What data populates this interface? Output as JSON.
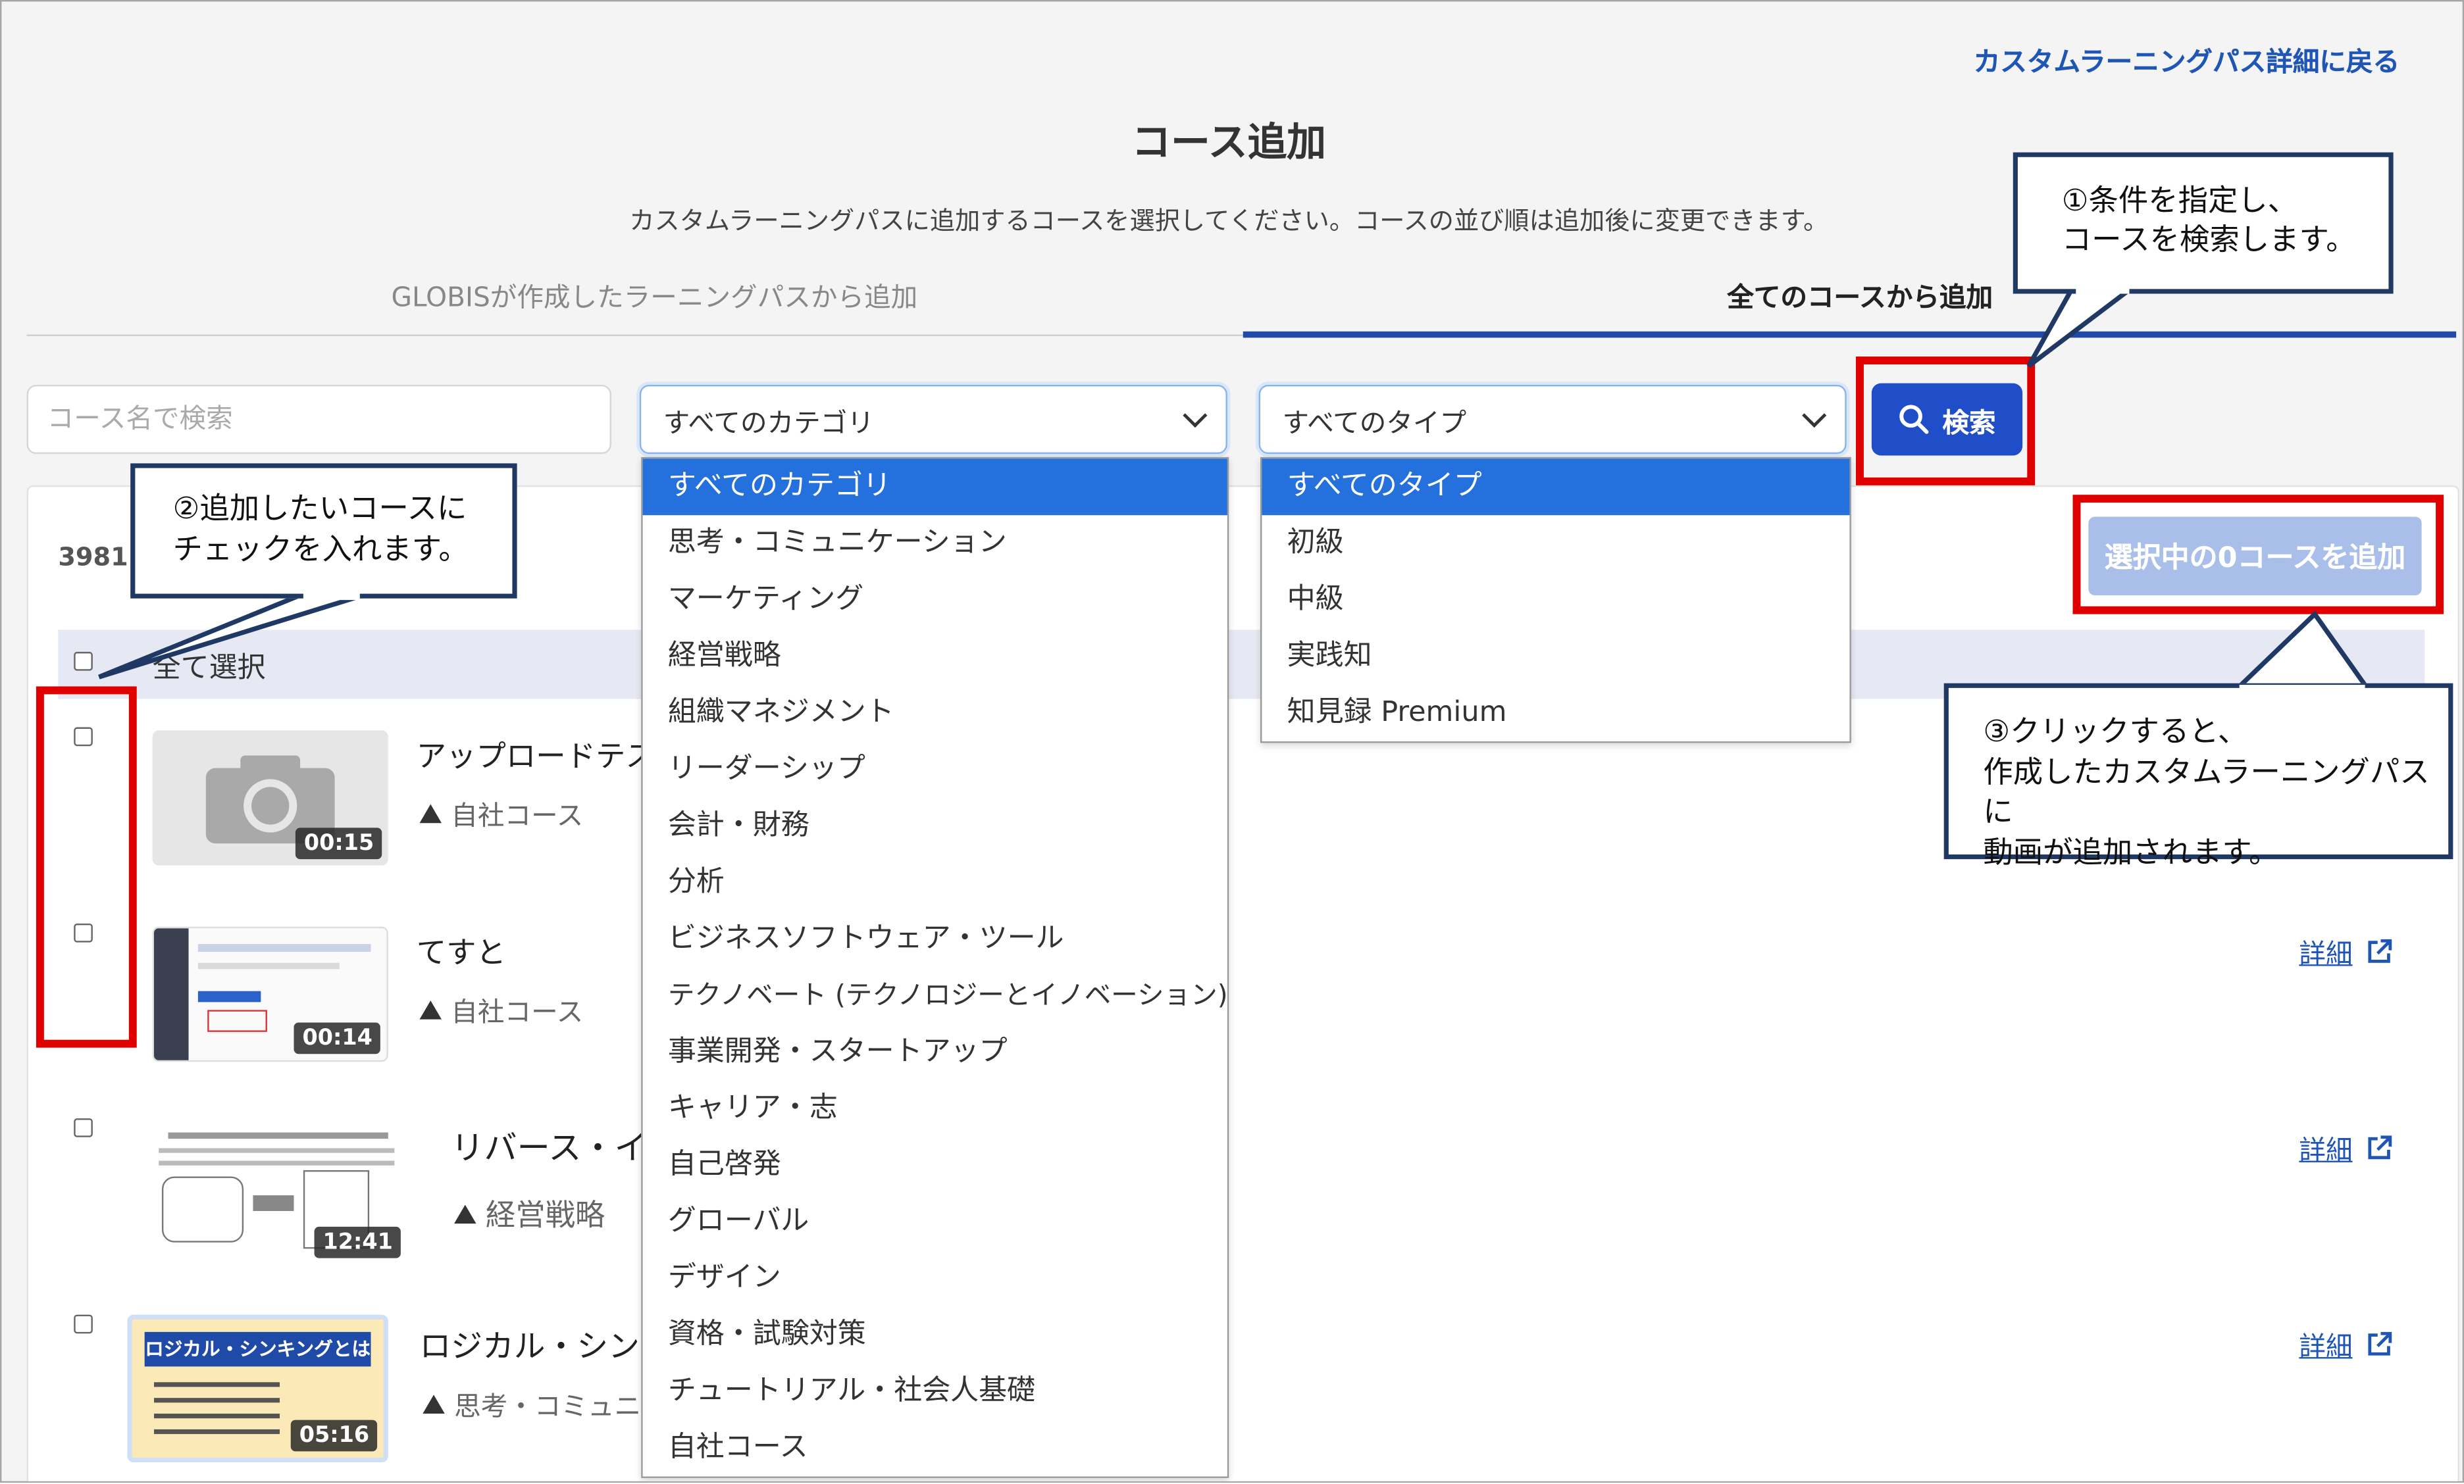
{
  "header": {
    "back_link": "カスタムラーニングパス詳細に戻る",
    "title": "コース追加",
    "subtitle": "カスタムラーニングパスに追加するコースを選択してください。コースの並び順は追加後に変更できます。"
  },
  "tabs": [
    {
      "label": "GLOBISが作成したラーニングパスから追加",
      "active": false
    },
    {
      "label": "全てのコースから追加",
      "active": true
    }
  ],
  "filters": {
    "search_placeholder": "コース名で検索",
    "category_selected": "すべてのカテゴリ",
    "type_selected": "すべてのタイプ",
    "search_button": "検索"
  },
  "category_options": [
    "すべてのカテゴリ",
    "思考・コミュニケーション",
    "マーケティング",
    "経営戦略",
    "組織マネジメント",
    "リーダーシップ",
    "会計・財務",
    "分析",
    "ビジネスソフトウェア・ツール",
    "テクノベート (テクノロジーとイノベーション)",
    "事業開発・スタートアップ",
    "キャリア・志",
    "自己啓発",
    "グローバル",
    "デザイン",
    "資格・試験対策",
    "チュートリアル・社会人基礎",
    "自社コース"
  ],
  "type_options": [
    "すべてのタイプ",
    "初級",
    "中級",
    "実践知",
    "知見録 Premium"
  ],
  "results": {
    "count_text": "3981",
    "add_button": "選択中の0コースを追加",
    "select_all_label": "全て選択"
  },
  "courses": [
    {
      "title": "アップロードテスト",
      "category": "自社コース",
      "duration": "00:15",
      "detail": ""
    },
    {
      "title": "てすと",
      "category": "自社コース",
      "duration": "00:14",
      "detail": "詳細"
    },
    {
      "title": "リバース・イノベ",
      "category": "経営戦略",
      "duration": "12:41",
      "detail": "詳細"
    },
    {
      "title": "ロジカル・シンキン",
      "category": "思考・コミュニケー",
      "duration": "05:16",
      "detail": "詳細",
      "thumb_label": "ロジカル・シンキングとは"
    }
  ],
  "callouts": {
    "c1": "①条件を指定し、\nコースを検索します。",
    "c2": "②追加したいコースに\nチェックを入れます。",
    "c3": "③クリックすると、\n作成したカスタムラーニングパスに\n動画が追加されます。"
  },
  "colors": {
    "primary": "#1f4ec8",
    "link": "#1f56b5",
    "dropdown_selected": "#2470dc",
    "annotation_red": "#e00000",
    "callout_border": "#1f3864",
    "disabled_button": "#a9bee8"
  }
}
